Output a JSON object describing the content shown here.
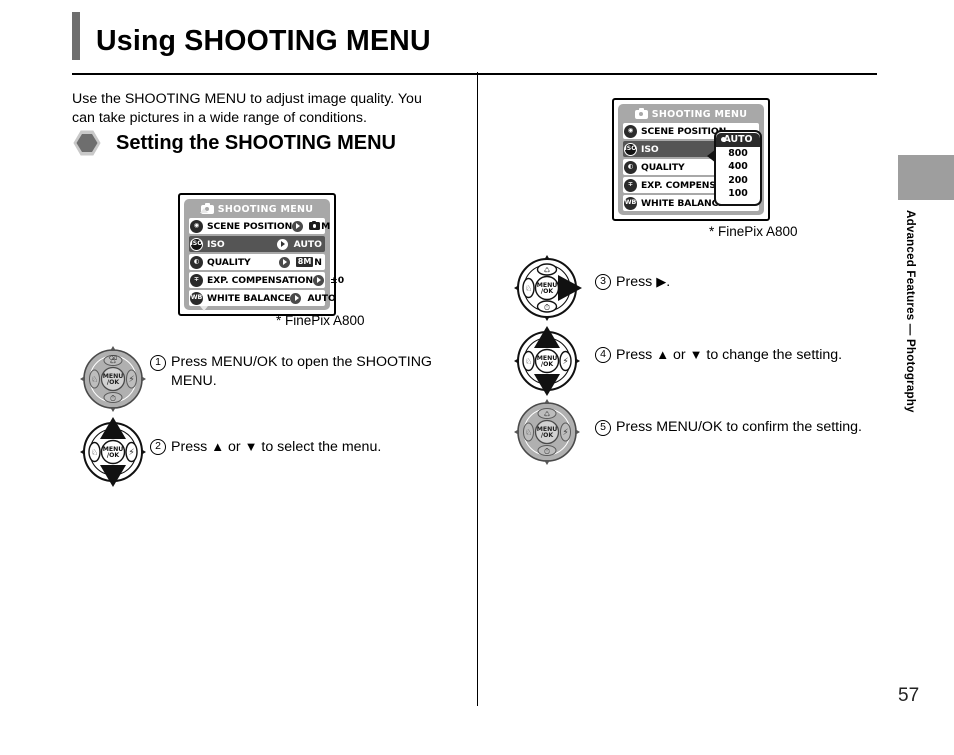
{
  "page": {
    "title": "Using SHOOTING MENU",
    "number": "57",
    "side_tab": "Advanced Features — Photography"
  },
  "intro": "Use the SHOOTING MENU to adjust image quality. You can take pictures in a wide range of conditions.",
  "section": {
    "bullet_icon": "hexagon-bullet-icon",
    "heading": "Setting the SHOOTING MENU"
  },
  "lcd_screen_1": {
    "header": {
      "icon": "camera-icon",
      "title": "SHOOTING MENU"
    },
    "rows": [
      {
        "icon_text": "☉",
        "icon_name": "scene-position-icon",
        "label": "SCENE POSITION",
        "value_type": "camera-m",
        "value": "M",
        "highlight": false
      },
      {
        "icon_text": "ISO",
        "icon_name": "iso-icon",
        "label": "ISO",
        "value_type": "text",
        "value": "AUTO",
        "highlight": true
      },
      {
        "icon_text": "◐",
        "icon_name": "quality-icon",
        "label": "QUALITY",
        "value_type": "badge-n",
        "value": "8M",
        "value_suffix": "N",
        "highlight": false
      },
      {
        "icon_text": "∓",
        "icon_name": "exposure-compensation-icon",
        "label": "EXP. COMPENSATION",
        "value_type": "text",
        "value": "±0",
        "highlight": false
      },
      {
        "icon_text": "WB",
        "icon_name": "white-balance-icon",
        "label": "WHITE BALANCE",
        "value_type": "text",
        "value": "AUTO",
        "highlight": false
      }
    ],
    "caption": "* FinePix A800"
  },
  "lcd_screen_2": {
    "header": {
      "icon": "camera-icon",
      "title": "SHOOTING MENU"
    },
    "rows": [
      {
        "icon_text": "☉",
        "icon_name": "scene-position-icon",
        "label": "SCENE POSITION",
        "highlight": false
      },
      {
        "icon_text": "ISO",
        "icon_name": "iso-icon",
        "label": "ISO",
        "highlight": true
      },
      {
        "icon_text": "◐",
        "icon_name": "quality-icon",
        "label": "QUALITY",
        "highlight": false
      },
      {
        "icon_text": "∓",
        "icon_name": "exposure-compensation-icon",
        "label": "EXP. COMPENSATION",
        "highlight": false
      },
      {
        "icon_text": "WB",
        "icon_name": "white-balance-icon",
        "label": "WHITE BALANCE",
        "highlight": false
      }
    ],
    "iso_options": [
      {
        "label": "AUTO",
        "selected": true
      },
      {
        "label": "800",
        "selected": false
      },
      {
        "label": "400",
        "selected": false
      },
      {
        "label": "200",
        "selected": false
      },
      {
        "label": "100",
        "selected": false
      }
    ],
    "caption": "* FinePix A800"
  },
  "steps": [
    {
      "num": "1",
      "text": "Press MENU/OK to open the SHOOTING MENU.",
      "controller": "neutral"
    },
    {
      "num": "2",
      "text_before": "Press ",
      "arrow1": "▲",
      "text_mid": " or ",
      "arrow2": "▼",
      "text_after": " to select the menu.",
      "controller": "up-down"
    },
    {
      "num": "3",
      "text_before": "Press ",
      "arrow1": "▶",
      "text_after": ".",
      "controller": "right"
    },
    {
      "num": "4",
      "text_before": "Press ",
      "arrow1": "▲",
      "text_mid": " or ",
      "arrow2": "▼",
      "text_after": " to change the setting.",
      "controller": "up-down"
    },
    {
      "num": "5",
      "text": "Press MENU/OK to confirm the setting.",
      "controller": "neutral"
    }
  ],
  "controller": {
    "center_label_line1": "MENU",
    "center_label_line2": "/OK",
    "top_icon": "trash-icon",
    "left_icon": "macro-icon",
    "right_icon": "flash-icon",
    "bottom_icon": "self-timer-icon"
  },
  "colors": {
    "title_rule": "#6e6e6e",
    "lcd_bg": "#a8a8a8",
    "highlight_row": "#555555",
    "side_tab": "#9e9e9e"
  }
}
